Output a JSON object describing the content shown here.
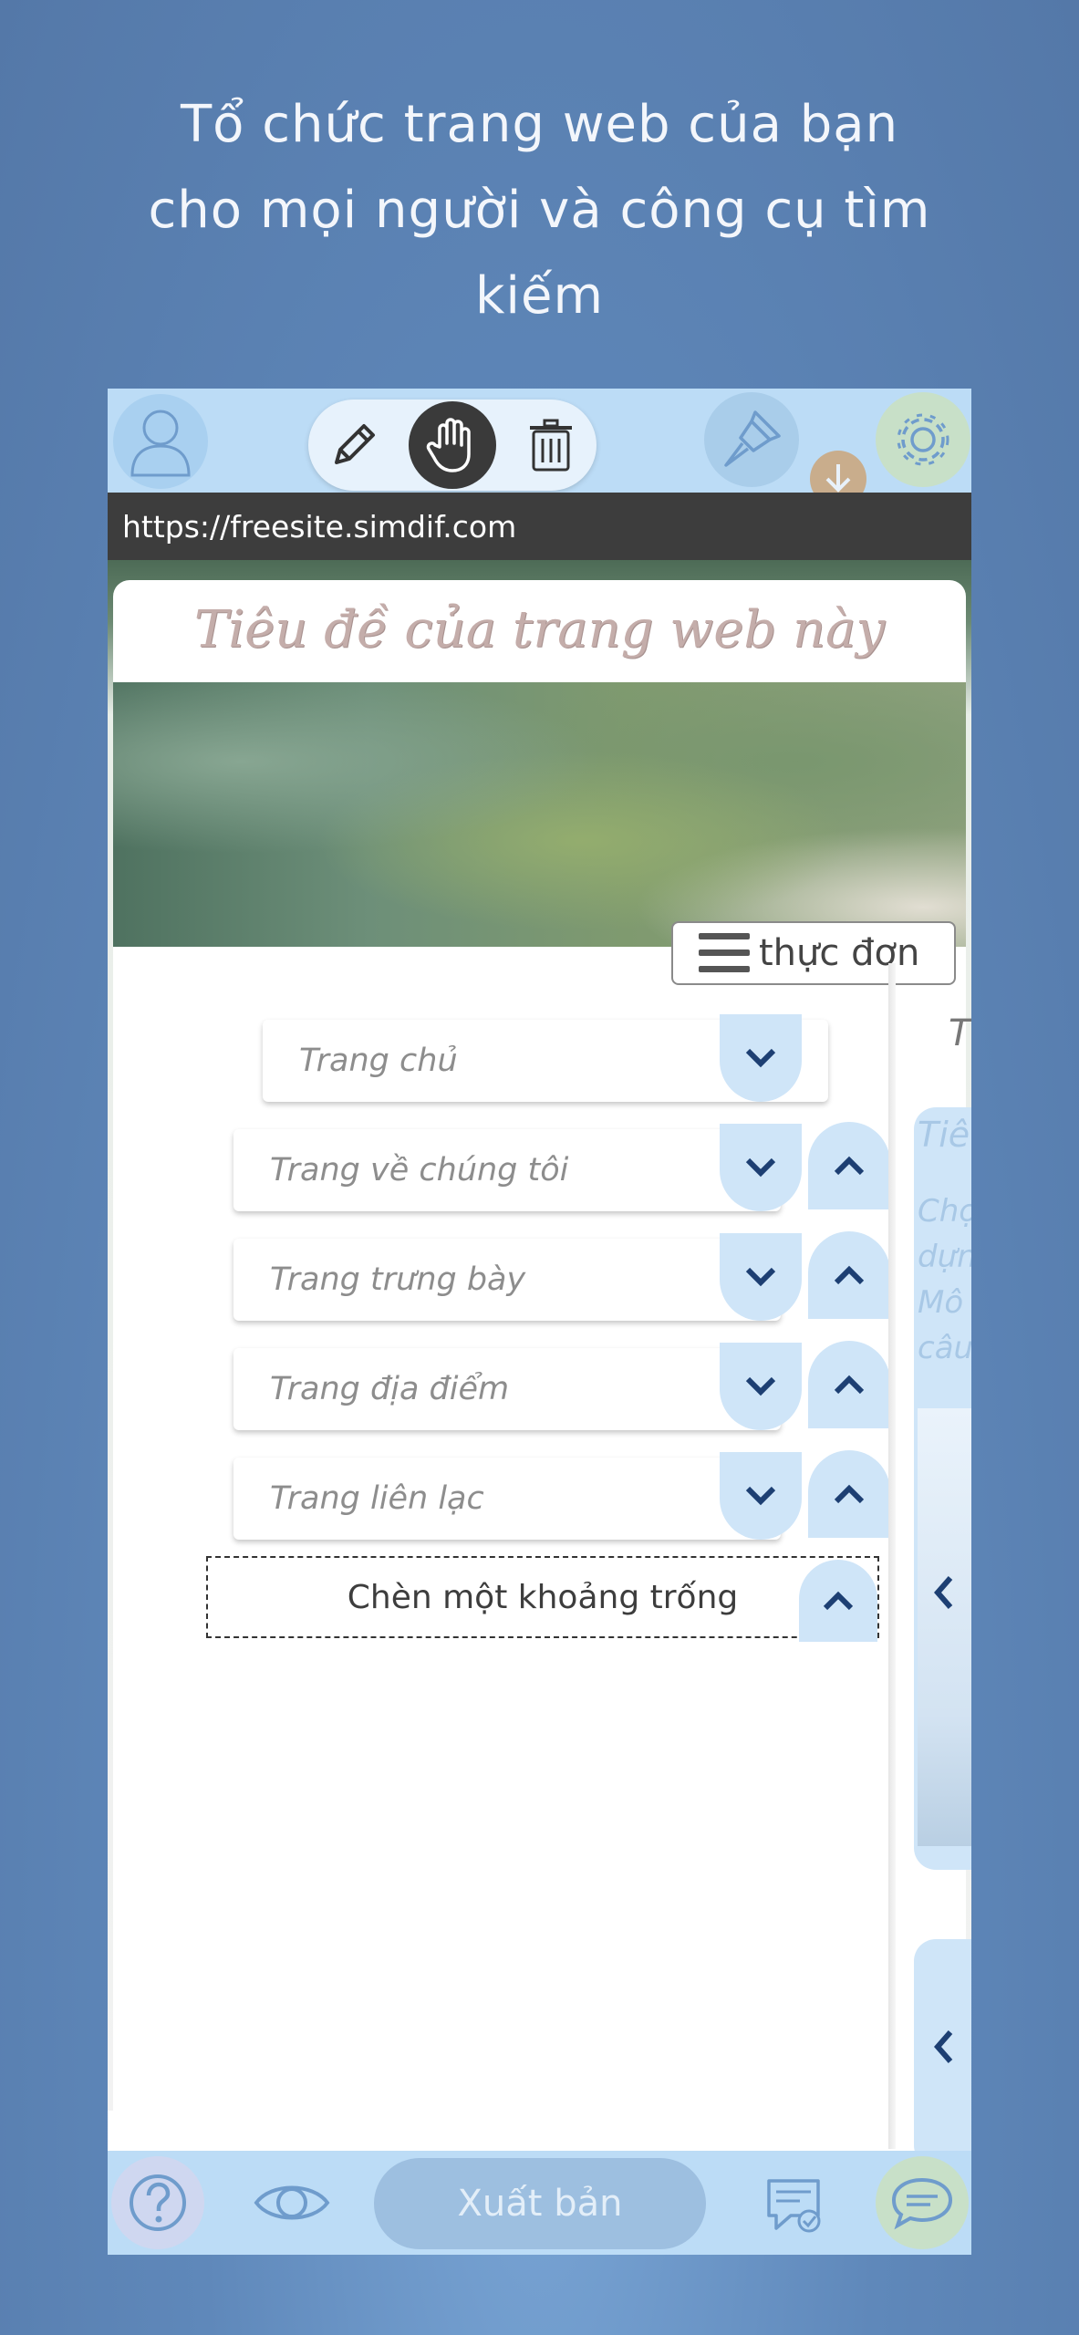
{
  "headline": {
    "line1": "Tổ chức trang web của bạn",
    "line2": "cho mọi người và công cụ tìm",
    "line3": "kiếm"
  },
  "toolbar": {
    "user_icon": "user-icon",
    "modes": [
      "pencil-icon",
      "hand-icon",
      "trash-icon"
    ],
    "active_mode": "hand-icon",
    "brush_icon": "paint-brush-icon",
    "download_icon": "download-icon",
    "settings_icon": "gear-icon"
  },
  "url": "https://freesite.simdif.com",
  "site": {
    "title": "Tiêu đề của trang web này",
    "menu_label": "thực đơn"
  },
  "pages": [
    {
      "label": "Trang chủ",
      "can_move_up": false
    },
    {
      "label": "Trang về chúng tôi",
      "can_move_up": true
    },
    {
      "label": "Trang trưng bày",
      "can_move_up": true
    },
    {
      "label": "Trang địa điểm",
      "can_move_up": true
    },
    {
      "label": "Trang liên lạc",
      "can_move_up": true
    }
  ],
  "insert_space_label": "Chèn một khoảng trống",
  "preview_panel": {
    "heading_fragment": "T",
    "block_title_fragment": "Tiê",
    "text_fragments": [
      "Chọ",
      "dựn",
      "Mô",
      "câu"
    ]
  },
  "bottombar": {
    "help_icon": "help-icon",
    "preview_icon": "eye-icon",
    "publish_label": "Xuất bản",
    "review_icon": "review-icon",
    "chat_icon": "chat-icon"
  },
  "colors": {
    "background": "#5f88ba",
    "toolbar": "#bcdcf6",
    "arrow_button": "#cfe5f8",
    "arrow_glyph": "#1d3f73",
    "urlbar": "#3d3d3d"
  }
}
